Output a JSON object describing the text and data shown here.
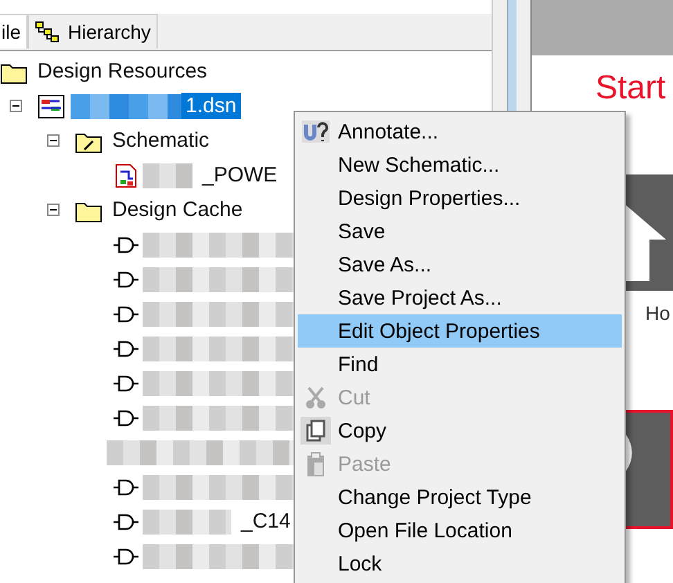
{
  "tabs": [
    {
      "label": "ile",
      "selected": true
    },
    {
      "label": "Hierarchy",
      "selected": false
    }
  ],
  "tree": [
    {
      "label": "Design Resources",
      "kind": "folder",
      "selected": false,
      "children": [
        {
          "label": "1.dsn",
          "kind": "design",
          "selected": true,
          "expanded": true,
          "children": [
            {
              "label": "Schematic",
              "kind": "schematic-folder",
              "selected": false,
              "expanded": true,
              "children": [
                {
                  "label": "_POWE",
                  "kind": "page",
                  "selected": false
                }
              ]
            },
            {
              "label": "Design Cache",
              "kind": "folder",
              "selected": false,
              "expanded": true,
              "children": [
                {
                  "kind": "part",
                  "selected": false
                },
                {
                  "kind": "part",
                  "selected": false
                },
                {
                  "kind": "part",
                  "selected": false
                },
                {
                  "kind": "part",
                  "selected": false
                },
                {
                  "kind": "part",
                  "selected": false
                },
                {
                  "kind": "part",
                  "selected": false
                },
                {
                  "kind": "blank",
                  "selected": false
                },
                {
                  "kind": "part",
                  "selected": false
                },
                {
                  "label": "_C14",
                  "kind": "part",
                  "selected": false
                },
                {
                  "kind": "part",
                  "selected": false
                }
              ]
            }
          ]
        }
      ]
    }
  ],
  "menu": [
    {
      "label": "Annotate...",
      "kind": "annotate",
      "disabled": false,
      "selected": false
    },
    {
      "label": "New Schematic...",
      "disabled": false,
      "selected": false
    },
    {
      "label": "Design Properties...",
      "disabled": false,
      "selected": false
    },
    {
      "label": "Save",
      "disabled": false,
      "selected": false
    },
    {
      "label": "Save As...",
      "disabled": false,
      "selected": false
    },
    {
      "label": "Save Project As...",
      "disabled": false,
      "selected": false
    },
    {
      "label": "Edit Object Properties",
      "disabled": false,
      "selected": true
    },
    {
      "label": "Find",
      "disabled": false,
      "selected": false
    },
    {
      "label": "Cut",
      "kind": "cut",
      "disabled": true,
      "selected": false
    },
    {
      "label": "Copy",
      "kind": "copy",
      "disabled": false,
      "selected": false
    },
    {
      "label": "Paste",
      "kind": "paste",
      "disabled": true,
      "selected": false
    },
    {
      "label": "Change Project Type",
      "disabled": false,
      "selected": false
    },
    {
      "label": "Open File Location",
      "disabled": false,
      "selected": false
    },
    {
      "label": "Lock",
      "disabled": false,
      "selected": false
    }
  ],
  "start_page": {
    "title": "Start",
    "tiles": [
      {
        "kind": "home",
        "label": "Ho"
      },
      {
        "kind": "tip"
      }
    ]
  }
}
